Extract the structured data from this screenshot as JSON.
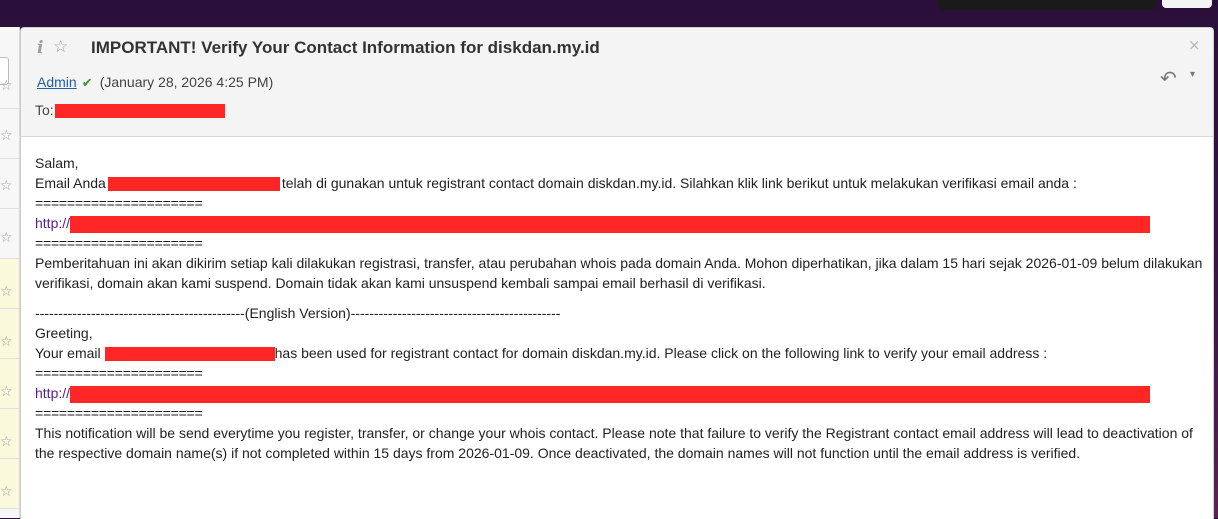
{
  "message": {
    "subject": "IMPORTANT! Verify Your Contact Information for diskdan.my.id",
    "sender": "Admin",
    "date": "(January 28, 2026 4:25 PM)",
    "to_label": "To:",
    "body": {
      "greeting_id": "Salam,",
      "email_prefix_id": "Email Anda",
      "email_suffix_id": "telah di gunakan untuk registrant contact domain diskdan.my.id. Silahkan klik link berikut untuk melakukan verifikasi email anda :",
      "separator": "=====================",
      "link_prefix": "http://",
      "notice_id": "Pemberitahuan ini akan dikirim setiap kali dilakukan registrasi, transfer, atau perubahan whois pada domain Anda. Mohon diperhatikan, jika dalam 15 hari sejak 2026-01-09 belum dilakukan verifikasi, domain akan kami suspend. Domain tidak akan kami unsuspend kembali sampai email berhasil di verifikasi.",
      "english_divider": "---------------------------------------------(English Version)---------------------------------------------",
      "greeting_en": "Greeting,",
      "email_prefix_en": "Your email",
      "email_suffix_en": "has been used for registrant contact for domain diskdan.my.id. Please click on the following link to verify your email address :",
      "notice_en": "This notification will be send everytime you register, transfer, or change your whois contact. Please note that failure to verify the Registrant contact email address will lead to deactivation of the respective domain name(s) if not completed within 15 days from 2026-01-09. Once deactivated, the domain names will not function until the email address is verified."
    }
  },
  "icons": {
    "info": "i",
    "star": "☆",
    "close": "×",
    "verified": "✔",
    "reply": "↶",
    "more": "▾"
  },
  "colors": {
    "redaction": "#ff2626",
    "link": "#5a1d8c",
    "sender_link": "#1f5fa8",
    "verified": "#2f9b2f"
  }
}
